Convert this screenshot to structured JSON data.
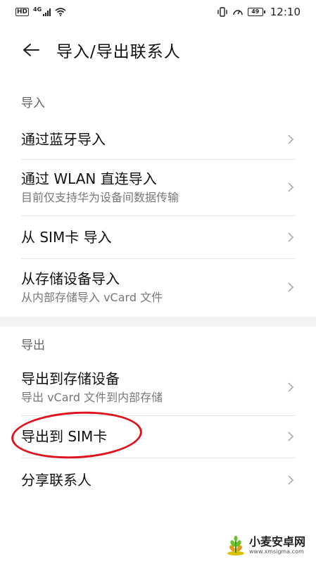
{
  "status_bar": {
    "hd": "HD",
    "network": "4G",
    "battery": "49",
    "time": "12:10"
  },
  "header": {
    "title": "导入/导出联系人"
  },
  "import_section": {
    "label": "导入",
    "items": [
      {
        "title": "通过蓝牙导入",
        "subtitle": ""
      },
      {
        "title": "通过 WLAN 直连导入",
        "subtitle": "目前仅支持华为设备间数据传输"
      },
      {
        "title": "从 SIM卡 导入",
        "subtitle": ""
      },
      {
        "title": "从存储设备导入",
        "subtitle": "从内部存储导入 vCard 文件"
      }
    ]
  },
  "export_section": {
    "label": "导出",
    "items": [
      {
        "title": "导出到存储设备",
        "subtitle": "导出 vCard 文件到内部存储"
      },
      {
        "title": "导出到 SIM卡",
        "subtitle": ""
      },
      {
        "title": "分享联系人",
        "subtitle": ""
      }
    ]
  },
  "watermark": {
    "name": "小麦安卓网",
    "url": "www.xmsigma.com"
  },
  "colors": {
    "annotation": "#e0141e",
    "section_label": "#666666",
    "subtitle": "#777777"
  }
}
